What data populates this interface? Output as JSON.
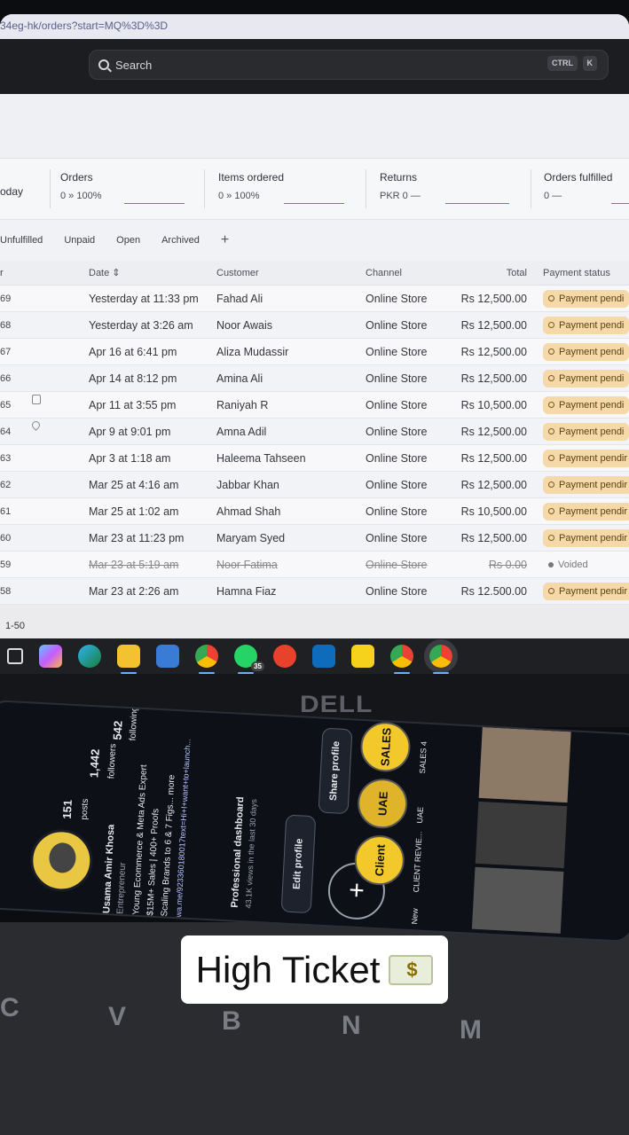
{
  "browser": {
    "url_fragment": "34eg-hk/orders?start=MQ%3D%3D",
    "search_placeholder": "Search",
    "shortcut_keys": [
      "CTRL",
      "K"
    ]
  },
  "metrics": {
    "period_label": "oday",
    "items": [
      {
        "label": "Orders",
        "value": "0 » 100%"
      },
      {
        "label": "Items ordered",
        "value": "0 » 100%"
      },
      {
        "label": "Returns",
        "value": "PKR 0 —"
      },
      {
        "label": "Orders fulfilled",
        "value": "0 —"
      }
    ]
  },
  "tabs": [
    "Unfulfilled",
    "Unpaid",
    "Open",
    "Archived",
    "+"
  ],
  "table": {
    "headers": [
      "r",
      "Date",
      "Customer",
      "Channel",
      "Total",
      "Payment status"
    ],
    "rows": [
      {
        "num": "69",
        "date": "Yesterday at 11:33 pm",
        "customer": "Fahad Ali",
        "channel": "Online Store",
        "total": "Rs 12,500.00",
        "status": "Payment pendi"
      },
      {
        "num": "68",
        "date": "Yesterday at 3:26 am",
        "customer": "Noor Awais",
        "channel": "Online Store",
        "total": "Rs 12,500.00",
        "status": "Payment pendi"
      },
      {
        "num": "67",
        "date": "Apr 16 at 6:41 pm",
        "customer": "Aliza Mudassir",
        "channel": "Online Store",
        "total": "Rs 12,500.00",
        "status": "Payment pendi"
      },
      {
        "num": "66",
        "date": "Apr 14 at 8:12 pm",
        "customer": "Amina Ali",
        "channel": "Online Store",
        "total": "Rs 12,500.00",
        "status": "Payment pendi"
      },
      {
        "num": "65",
        "date": "Apr 11 at 3:55 pm",
        "customer": "Raniyah R",
        "channel": "Online Store",
        "total": "Rs 10,500.00",
        "status": "Payment pendi"
      },
      {
        "num": "64",
        "date": "Apr 9 at 9:01 pm",
        "customer": "Amna Adil",
        "channel": "Online Store",
        "total": "Rs 12,500.00",
        "status": "Payment pendi"
      },
      {
        "num": "63",
        "date": "Apr 3 at 1:18 am",
        "customer": "Haleema Tahseen",
        "channel": "Online Store",
        "total": "Rs 12,500.00",
        "status": "Payment pendir"
      },
      {
        "num": "62",
        "date": "Mar 25 at 4:16 am",
        "customer": "Jabbar Khan",
        "channel": "Online Store",
        "total": "Rs 12,500.00",
        "status": "Payment pendir"
      },
      {
        "num": "61",
        "date": "Mar 25 at 1:02 am",
        "customer": "Ahmad Shah",
        "channel": "Online Store",
        "total": "Rs 10,500.00",
        "status": "Payment pendir"
      },
      {
        "num": "60",
        "date": "Mar 23 at 11:23 pm",
        "customer": "Maryam Syed",
        "channel": "Online Store",
        "total": "Rs 12,500.00",
        "status": "Payment pendir"
      },
      {
        "num": "59",
        "date": "Mar 23 at 5:19 am",
        "customer": "Noor Fatima",
        "channel": "Online Store",
        "total": "Rs 0.00",
        "status": "Voided"
      },
      {
        "num": "58",
        "date": "Mar 23 at 2:26 am",
        "customer": "Hamna Fiaz",
        "channel": "Online Store",
        "total": "Rs 12.500.00",
        "status": "Payment pendir"
      }
    ]
  },
  "pagination": "1-50",
  "taskbar": {
    "badge_count": "35"
  },
  "brand": "DELL",
  "phone": {
    "posts_count": "151",
    "posts_label": "posts",
    "followers_count": "1,442",
    "followers_label": "followers",
    "following_count": "542",
    "following_label": "following",
    "name": "Usama Amir Khosa",
    "role": "Entrepreneur",
    "bio1": "Young Ecommerce & Meta Ads Expert",
    "bio2": "$15M+ Sales | 400+ Proofs",
    "bio3": "Scaling Brands to 6 & 7 Figs... more",
    "link": "wa.me/923360180017text=Hi+I+want+to+launch...",
    "dashboard_title": "Professional dashboard",
    "dashboard_sub": "43.1K views in the last 30 days",
    "edit_profile": "Edit profile",
    "share_profile": "Share profile",
    "highlights": [
      "SALES",
      "UAE",
      "Client"
    ],
    "highlight_labels": [
      "SALES 4",
      "UAE",
      "CLIENT REVIE..."
    ],
    "new_label": "New"
  },
  "keyboard_keys": [
    "C",
    "V",
    "B",
    "N",
    "M"
  ],
  "caption": "High Ticket"
}
